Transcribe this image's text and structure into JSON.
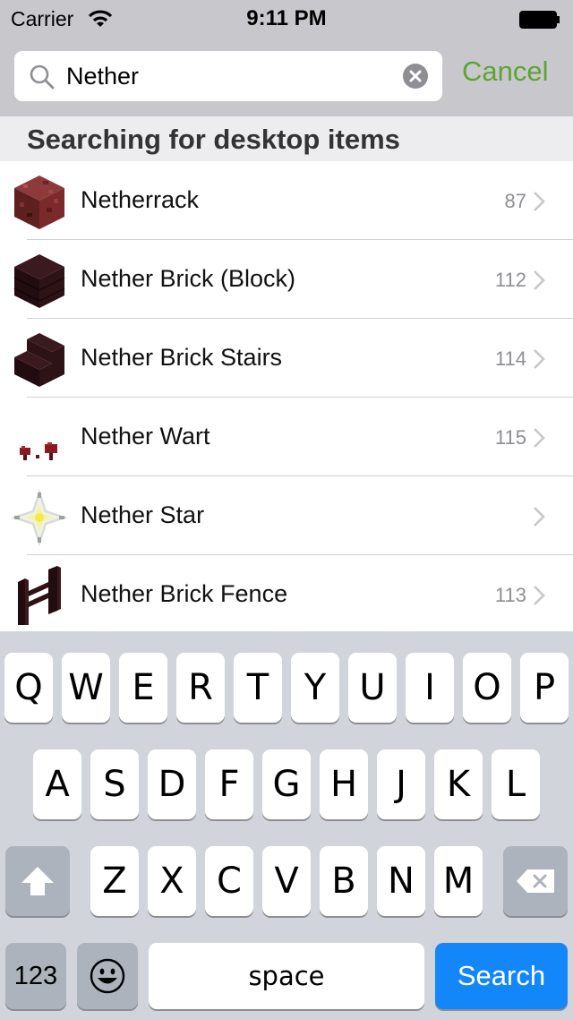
{
  "status_bar": {
    "carrier": "Carrier",
    "time": "9:11 PM"
  },
  "search": {
    "query": "Nether",
    "cancel_label": "Cancel"
  },
  "section": {
    "title": "Searching for desktop items"
  },
  "results": [
    {
      "name": "Netherrack",
      "count": "87",
      "icon": "netherrack-icon"
    },
    {
      "name": "Nether Brick (Block)",
      "count": "112",
      "icon": "nether-brick-block-icon"
    },
    {
      "name": "Nether Brick Stairs",
      "count": "114",
      "icon": "nether-brick-stairs-icon"
    },
    {
      "name": "Nether Wart",
      "count": "115",
      "icon": "nether-wart-icon"
    },
    {
      "name": "Nether Star",
      "count": "",
      "icon": "nether-star-icon"
    },
    {
      "name": "Nether Brick Fence",
      "count": "113",
      "icon": "nether-brick-fence-icon"
    }
  ],
  "keyboard": {
    "row1": [
      "Q",
      "W",
      "E",
      "R",
      "T",
      "Y",
      "U",
      "I",
      "O",
      "P"
    ],
    "row2": [
      "A",
      "S",
      "D",
      "F",
      "G",
      "H",
      "J",
      "K",
      "L"
    ],
    "row3": [
      "Z",
      "X",
      "C",
      "V",
      "B",
      "N",
      "M"
    ],
    "numbers_label": "123",
    "space_label": "space",
    "search_label": "Search"
  },
  "colors": {
    "accent": "#5ba533",
    "search_key": "#1387f9"
  }
}
